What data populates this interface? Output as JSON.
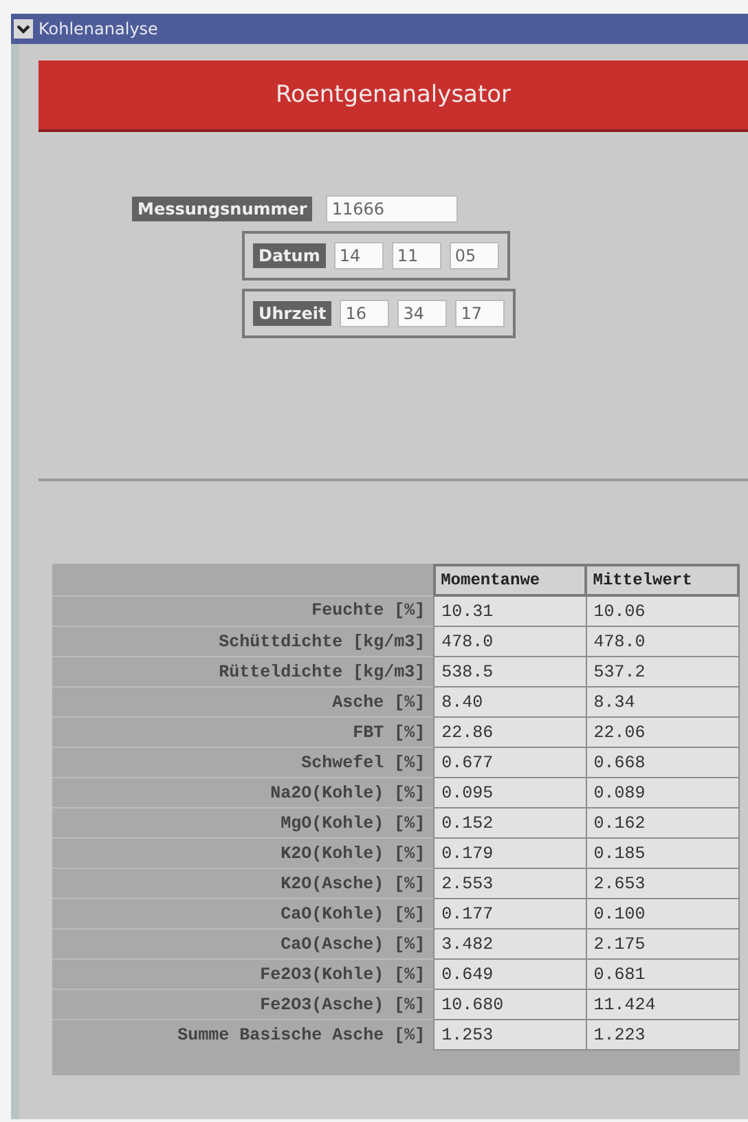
{
  "window": {
    "title": "Kohlenanalyse"
  },
  "header": {
    "title": "Roentgenanalysator"
  },
  "measurement": {
    "label": "Messungsnummer",
    "value": "11666"
  },
  "date": {
    "label": "Datum",
    "parts": [
      "14",
      "11",
      "05"
    ]
  },
  "time": {
    "label": "Uhrzeit",
    "parts": [
      "16",
      "34",
      "17"
    ]
  },
  "table": {
    "columns": [
      "Momentanwe",
      "Mittelwert"
    ],
    "rows": [
      {
        "label": "Feuchte [%]",
        "values": [
          "10.31",
          "10.06"
        ]
      },
      {
        "label": "Schüttdichte [kg/m3]",
        "values": [
          "478.0",
          "478.0"
        ]
      },
      {
        "label": "Rütteldichte [kg/m3]",
        "values": [
          "538.5",
          "537.2"
        ]
      },
      {
        "label": "Asche [%]",
        "values": [
          "8.40",
          "8.34"
        ]
      },
      {
        "label": "FBT [%]",
        "values": [
          "22.86",
          "22.06"
        ]
      },
      {
        "label": "Schwefel [%]",
        "values": [
          "0.677",
          "0.668"
        ]
      },
      {
        "label": "Na2O(Kohle) [%]",
        "values": [
          "0.095",
          "0.089"
        ]
      },
      {
        "label": "MgO(Kohle) [%]",
        "values": [
          "0.152",
          "0.162"
        ]
      },
      {
        "label": "K2O(Kohle) [%]",
        "values": [
          "0.179",
          "0.185"
        ]
      },
      {
        "label": "K2O(Asche) [%]",
        "values": [
          "2.553",
          "2.653"
        ]
      },
      {
        "label": "CaO(Kohle) [%]",
        "values": [
          "0.177",
          "0.100"
        ]
      },
      {
        "label": "CaO(Asche) [%]",
        "values": [
          "3.482",
          "2.175"
        ]
      },
      {
        "label": "Fe2O3(Kohle) [%]",
        "values": [
          "0.649",
          "0.681"
        ]
      },
      {
        "label": "Fe2O3(Asche) [%]",
        "values": [
          "10.680",
          "11.424"
        ]
      },
      {
        "label": "Summe Basische Asche [%]",
        "values": [
          "1.253",
          "1.223"
        ]
      }
    ]
  }
}
